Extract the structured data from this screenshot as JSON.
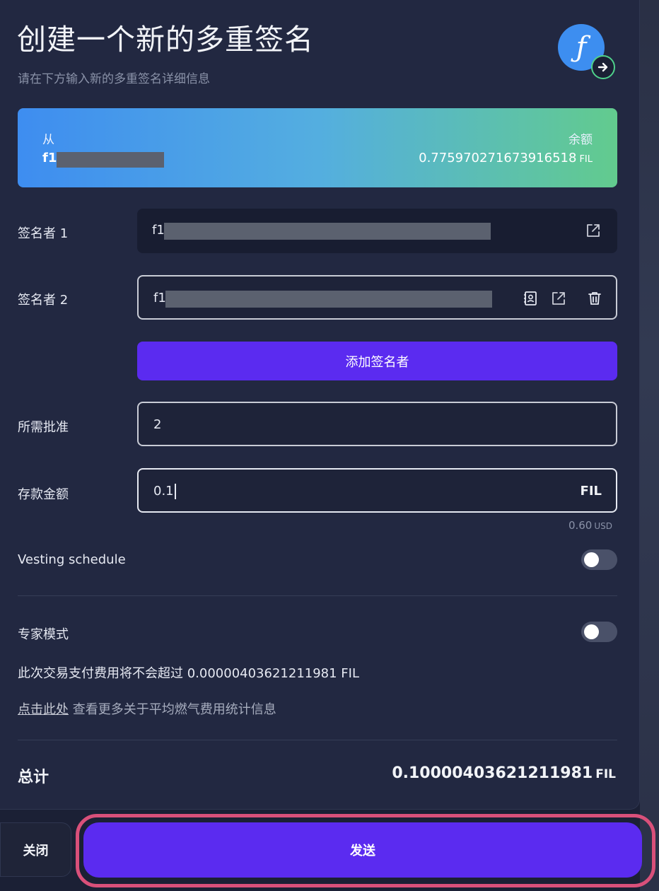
{
  "header": {
    "title": "创建一个新的多重签名",
    "subtitle": "请在下方输入新的多重签名详细信息"
  },
  "from": {
    "label": "从",
    "address_prefix": "f1",
    "balance_label": "余额",
    "balance_value": "0.775970271673916518",
    "balance_unit": "FIL"
  },
  "signers": [
    {
      "label": "签名者 1",
      "value_prefix": "f1"
    },
    {
      "label": "签名者 2",
      "value_prefix": "f1"
    }
  ],
  "add_signer_label": "添加签名者",
  "approvals": {
    "label": "所需批准",
    "value": "2"
  },
  "deposit": {
    "label": "存款金额",
    "value": "0.1",
    "unit": "FIL",
    "usd_value": "0.60",
    "usd_unit": "USD"
  },
  "vesting": {
    "label": "Vesting schedule",
    "enabled": false
  },
  "expert": {
    "label": "专家模式",
    "enabled": false
  },
  "fee_note": "此次交易支付费用将不会超过 0.00000403621211981 FIL",
  "gas_link": {
    "link_text": "点击此处",
    "rest_text": " 查看更多关于平均燃气费用统计信息"
  },
  "total": {
    "label": "总计",
    "value": "0.10000403621211981",
    "unit": "FIL"
  },
  "footer": {
    "close_label": "关闭",
    "send_label": "发送"
  },
  "colors": {
    "accent": "#5b2bf0",
    "gradient_start": "#3e8df0",
    "gradient_end": "#62cb8e",
    "highlight_outline": "#d9507a"
  }
}
